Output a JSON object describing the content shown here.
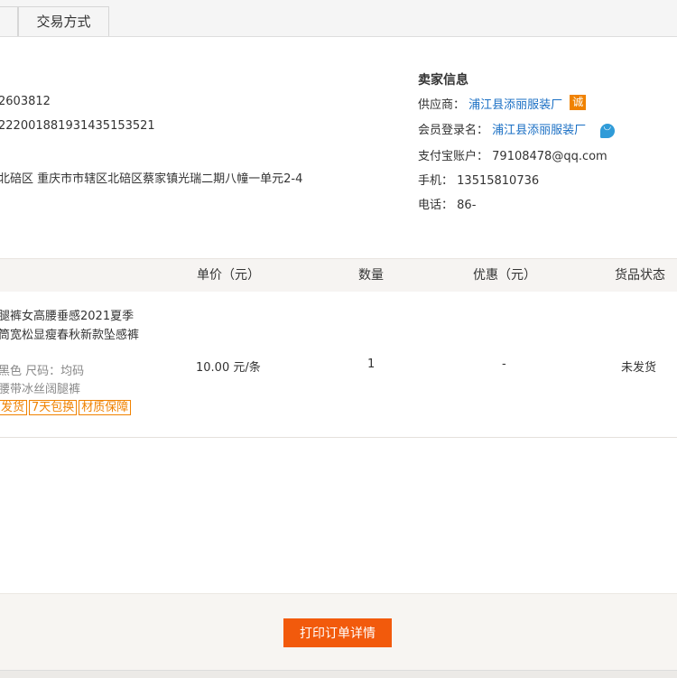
{
  "tabs": [
    {
      "label": ""
    },
    {
      "label": "交易方式"
    }
  ],
  "buyer": {
    "phone_partial": "2603812",
    "id_partial": "2220018819314351535​21",
    "address_partial": "北碚区 重庆市市辖区北碚区蔡家镇光瑞二期八幢一单元2-4"
  },
  "seller": {
    "title": "卖家信息",
    "supplier_label": "供应商：",
    "supplier_value": "浦江县添丽服装厂",
    "supplier_badge": "诚",
    "member_label": "会员登录名：",
    "member_value": "浦江县添丽服装厂",
    "alipay_label": "支付宝账户：",
    "alipay_value": "79108478@qq.com",
    "mobile_label": "手机：",
    "mobile_value": "13515810736",
    "tel_label": "电话：",
    "tel_value": "86-"
  },
  "table": {
    "headers": {
      "unit_price": "单价（元）",
      "quantity": "数量",
      "discount": "优惠（元）",
      "status": "货品状态"
    },
    "item": {
      "title_line1": "腿裤女高腰垂感2021夏季",
      "title_line2": "筒宽松显瘦春秋新款坠感裤",
      "spec_line1": "黑色  尺码：均码",
      "spec_line2": "腰带冰丝阔腿裤",
      "tags": [
        "发货",
        "7天包换",
        "材质保障"
      ],
      "unit_price": "10.00 元/条",
      "quantity": "1",
      "discount": "-",
      "status": "未发货"
    }
  },
  "footer": {
    "print_button": "打印订单详情"
  },
  "colors": {
    "accent": "#f25a0c",
    "link": "#1a6fc4",
    "tag": "#f08200"
  }
}
